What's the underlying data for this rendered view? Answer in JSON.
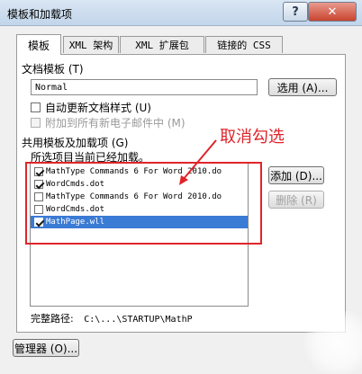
{
  "window": {
    "title": "模板和加载项",
    "help_label": "?",
    "close_label": "✕"
  },
  "tabs": [
    {
      "label": "模板",
      "active": true
    },
    {
      "label": "XML 架构",
      "active": false
    },
    {
      "label": "XML 扩展包",
      "active": false
    },
    {
      "label": "链接的 CSS",
      "active": false
    }
  ],
  "doc_template": {
    "label": "文档模板 (T)",
    "value": "Normal",
    "attach_button": "选用 (A)..."
  },
  "options": {
    "auto_update": {
      "label": "自动更新文档样式 (U)",
      "checked": false,
      "enabled": true
    },
    "attach_email": {
      "label": "附加到所有新电子邮件中 (M)",
      "checked": false,
      "enabled": false
    }
  },
  "global_templates": {
    "group_label": "共用模板及加载项 (G)",
    "loaded_note": "所选项目当前已经加载。",
    "items": [
      {
        "label": "MathType Commands 6 For Word 2010.do",
        "checked": true,
        "selected": false
      },
      {
        "label": "WordCmds.dot",
        "checked": true,
        "selected": false
      },
      {
        "label": "MathType Commands 6 For Word 2010.do",
        "checked": false,
        "selected": false
      },
      {
        "label": "WordCmds.dot",
        "checked": false,
        "selected": false
      },
      {
        "label": "MathPage.wll",
        "checked": true,
        "selected": true
      }
    ],
    "add_button": "添加 (D)...",
    "remove_button": "删除 (R)"
  },
  "full_path": {
    "label": "完整路径:",
    "value": "C:\\...\\STARTUP\\MathP"
  },
  "organizer_button": "管理器 (O)...",
  "annotation": {
    "text": "取消勾选",
    "color": "#e0242a"
  },
  "colors": {
    "selection": "#3a7bd5",
    "annotation_red": "#e0242a"
  }
}
